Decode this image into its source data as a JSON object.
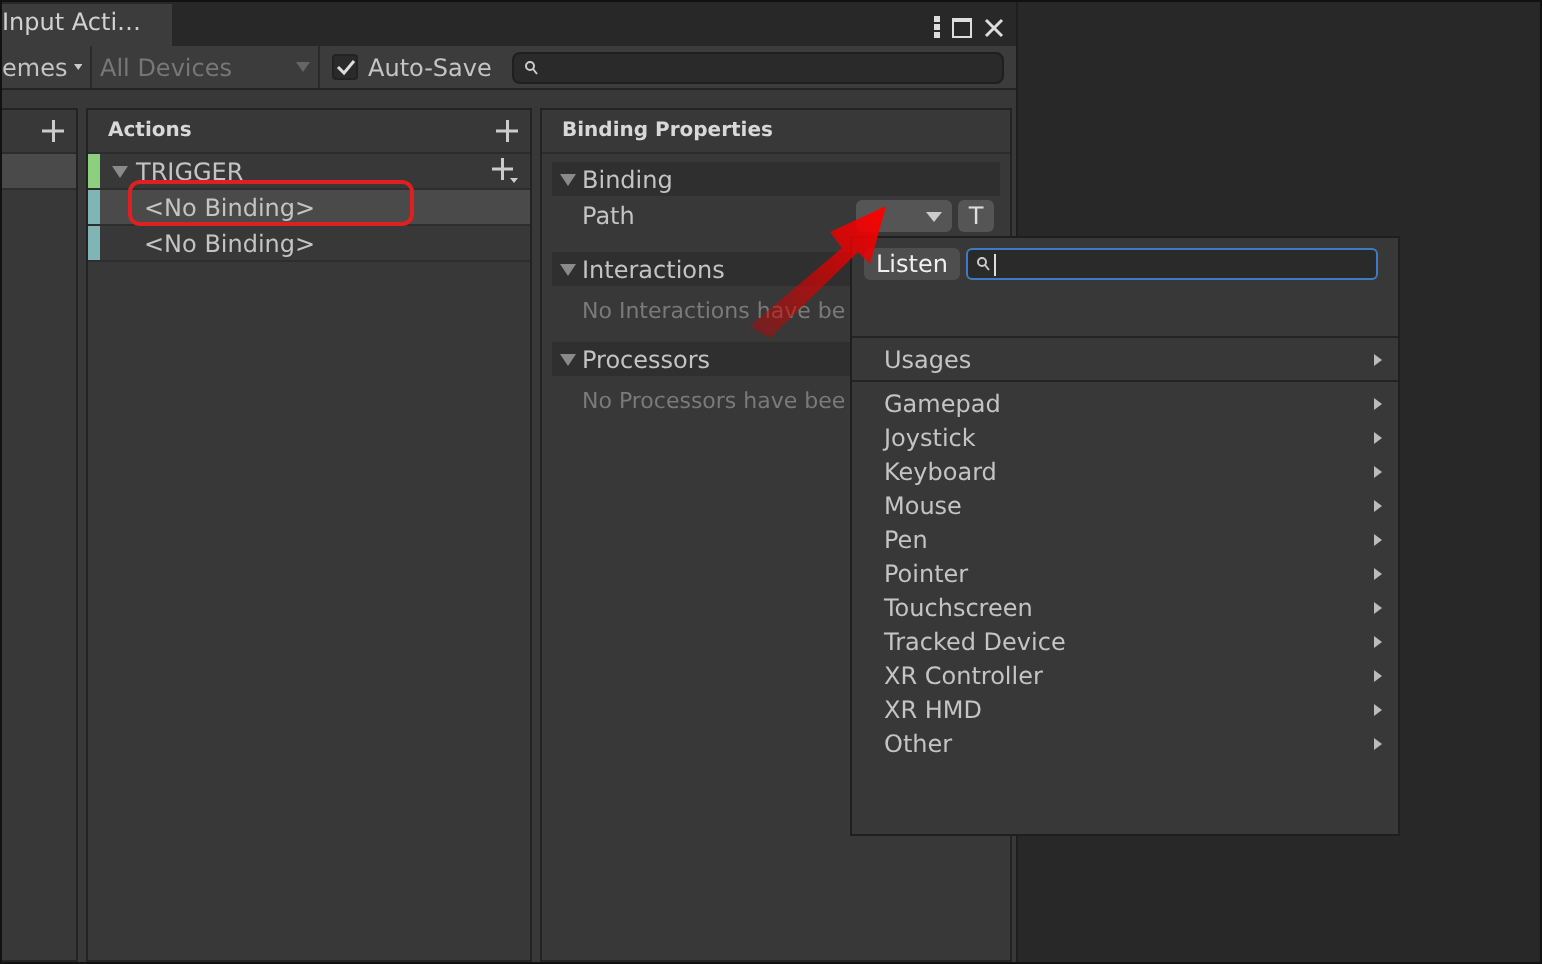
{
  "window": {
    "tab_title": "Input Acti…"
  },
  "toolbar": {
    "control_schemes": "emes",
    "devices": {
      "value": "All Devices",
      "disabled": true
    },
    "auto_save": {
      "label": "Auto-Save",
      "checked": true
    }
  },
  "actions": {
    "title": "Actions",
    "items": [
      {
        "name": "TRIGGER",
        "color": "#8ccf7e",
        "expanded": true,
        "children": [
          {
            "name": "<No Binding>",
            "color": "#7fb5b5",
            "selected": true
          },
          {
            "name": "<No Binding>",
            "color": "#7fb5b5",
            "selected": false
          }
        ]
      }
    ]
  },
  "properties": {
    "title": "Binding Properties",
    "sections": [
      {
        "kind": "path",
        "title": "Binding",
        "expanded": true,
        "label": "Path",
        "toggle": "T"
      },
      {
        "kind": "empty",
        "title": "Interactions",
        "expanded": true,
        "text": "No Interactions have be"
      },
      {
        "kind": "empty",
        "title": "Processors",
        "expanded": true,
        "text": "No Processors have bee"
      }
    ]
  },
  "popup": {
    "listen": "Listen",
    "groups": [
      [
        {
          "label": "Usages"
        }
      ],
      [
        {
          "label": "Gamepad"
        },
        {
          "label": "Joystick"
        },
        {
          "label": "Keyboard"
        },
        {
          "label": "Mouse"
        },
        {
          "label": "Pen"
        },
        {
          "label": "Pointer"
        },
        {
          "label": "Touchscreen"
        },
        {
          "label": "Tracked Device"
        },
        {
          "label": "XR Controller"
        },
        {
          "label": "XR HMD"
        },
        {
          "label": "Other"
        }
      ]
    ]
  }
}
